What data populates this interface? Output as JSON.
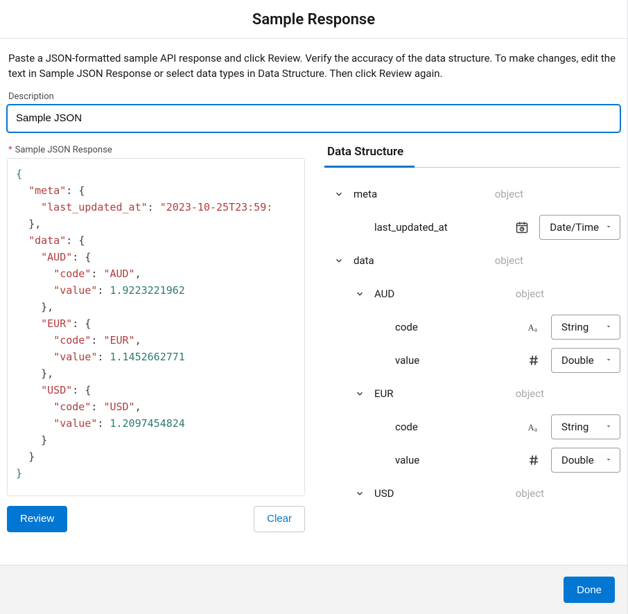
{
  "header": {
    "title": "Sample Response"
  },
  "instructions": "Paste a JSON-formatted sample API response and click Review. Verify the accuracy of the data structure. To make changes, edit the text in Sample JSON Response or select data types in Data Structure. Then click Review again.",
  "description_field": {
    "label": "Description",
    "value": "Sample JSON"
  },
  "json_field": {
    "label": "Sample JSON Response",
    "required_marker": "*"
  },
  "json_sample": {
    "meta": {
      "last_updated_at": "2023-10-25T23:59:"
    },
    "data": {
      "AUD": {
        "code": "AUD",
        "value": 1.9223221962
      },
      "EUR": {
        "code": "EUR",
        "value": 1.1452662771
      },
      "USD": {
        "code": "USD",
        "value": 1.2097454824
      }
    }
  },
  "json_tokens": {
    "k_meta": "\"meta\"",
    "k_lua": "\"last_updated_at\"",
    "v_lua": "\"2023-10-25T23:59:",
    "k_data": "\"data\"",
    "k_aud": "\"AUD\"",
    "k_code": "\"code\"",
    "v_aud": "\"AUD\"",
    "k_value": "\"value\"",
    "n_aud": "1.9223221962",
    "k_eur": "\"EUR\"",
    "v_eur": "\"EUR\"",
    "n_eur": "1.1452662771",
    "k_usd": "\"USD\"",
    "v_usd": "\"USD\"",
    "n_usd": "1.2097454824"
  },
  "buttons": {
    "review": "Review",
    "clear": "Clear",
    "done": "Done"
  },
  "data_structure": {
    "title": "Data Structure",
    "type_labels": {
      "object": "object",
      "string": "String",
      "double": "Double",
      "datetime": "Date/Time"
    },
    "nodes": {
      "meta": "meta",
      "last_updated_at": "last_updated_at",
      "data": "data",
      "AUD": "AUD",
      "EUR": "EUR",
      "USD": "USD",
      "code": "code",
      "value": "value"
    }
  }
}
